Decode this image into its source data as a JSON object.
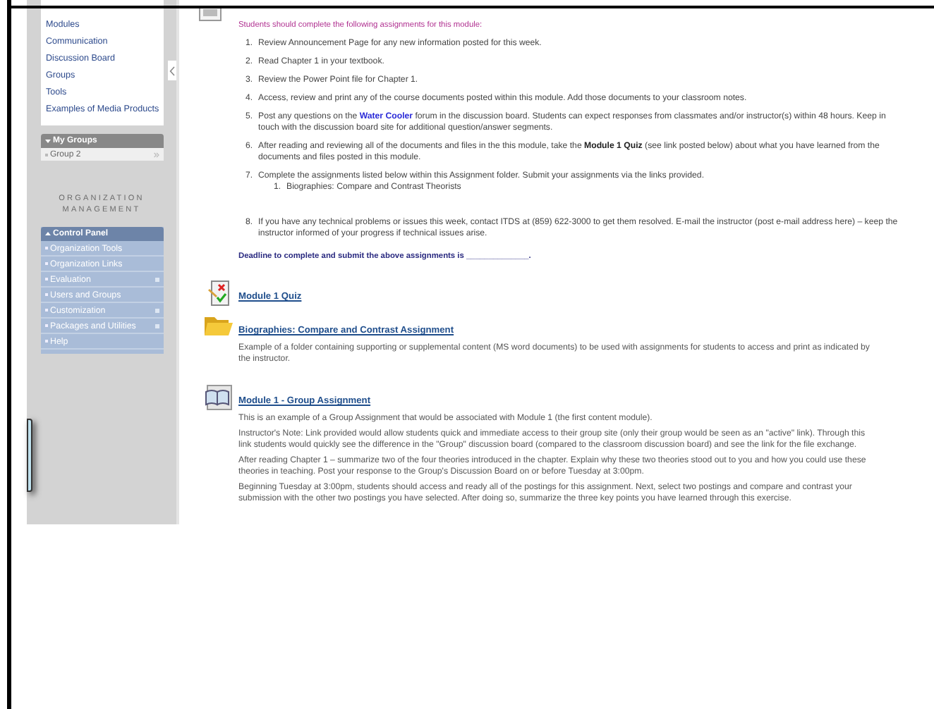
{
  "course_menu": {
    "items": [
      "Modules",
      "Communication",
      "Discussion Board",
      "Groups",
      "Tools",
      "Examples of Media Products"
    ]
  },
  "my_groups": {
    "title": "My Groups",
    "expanded": true,
    "items": [
      {
        "label": "Group 2",
        "has_submenu": true
      }
    ]
  },
  "organization_heading": "ORGANIZATION MANAGEMENT",
  "control_panel": {
    "title": "Control Panel",
    "expanded": true,
    "items": [
      {
        "label": "Organization Tools",
        "has_submenu": false
      },
      {
        "label": "Organization Links",
        "has_submenu": false
      },
      {
        "label": "Evaluation",
        "has_submenu": true
      },
      {
        "label": "Users and Groups",
        "has_submenu": false
      },
      {
        "label": "Customization",
        "has_submenu": true
      },
      {
        "label": "Packages and Utilities",
        "has_submenu": true
      },
      {
        "label": "Help",
        "has_submenu": false
      }
    ]
  },
  "intro": "Students should complete the following assignments for this module:",
  "assignments": [
    {
      "number": "1.",
      "text": "Review Announcement Page for any new information posted for this week."
    },
    {
      "number": "2.",
      "text": "Read Chapter 1 in your textbook."
    },
    {
      "number": "3.",
      "text": "Review the Power Point file for Chapter 1."
    },
    {
      "number": "4.",
      "text": "Access, review and print any of the course documents posted within this module. Add those documents to your classroom notes."
    },
    {
      "number": "5.",
      "text": "Post any questions on the ",
      "link": "Water Cooler",
      "after": " forum in the discussion board. Students can expect responses from classmates and/or instructor(s) within 48 hours. Keep in touch with the discussion board site for additional question/answer segments."
    },
    {
      "number": "6.",
      "text": "After reading and reviewing all of the documents and files in the this module, take the **Module 1 Quiz** (see link posted below) about what you have learned from the documents and files posted in this module."
    },
    {
      "number": "7.",
      "text": "Complete the assignments listed below within this Assignment folder. Submit your assignments via the links provided.",
      "children": [
        {
          "number": "1.",
          "text": "Biographies: Compare and Contrast Theorists"
        }
      ]
    },
    {
      "number": "8.",
      "text": "If you have any technical problems or issues this week, contact ITDS at (859) 622-3000 to get them resolved. E-mail the instructor (post e-mail address here) – keep the instructor informed of your progress if technical issues arise."
    }
  ],
  "deadline": "Deadline to complete and submit the above assignments is ______________.",
  "content_items": [
    {
      "kind": "quiz",
      "title": "Module 1 Quiz"
    },
    {
      "kind": "folder",
      "title": "Biographies: Compare and Contrast Assignment",
      "paragraphs": [
        "Example of a folder containing supporting or supplemental content (MS word documents) to be used with assignments for students to access and print as indicated by the instructor."
      ]
    },
    {
      "kind": "book",
      "title": "Module 1 - Group Assignment",
      "paragraphs": [
        "This is an example of a Group Assignment that would be associated with Module 1 (the first content module).",
        "Instructor's Note: Link provided would allow students quick and immediate access to their group site (only their group would be seen as an \"active\" link). Through this link students would quickly see the difference in the \"Group\" discussion board (compared to the classroom discussion board) and see the link for the file exchange.",
        "After reading Chapter 1 – summarize two of the four theories introduced in the chapter. Explain why these two theories stood out to you and how you could use these theories in teaching. Post your response to the Group's Discussion Board on or before Tuesday at 3:00pm.",
        "Beginning Tuesday at 3:00pm, students should access and ready all of the postings for this assignment. Next, select two postings and compare and contrast your submission with the other two postings you have selected. After doing so, summarize the three key points you have learned through this exercise."
      ]
    }
  ]
}
